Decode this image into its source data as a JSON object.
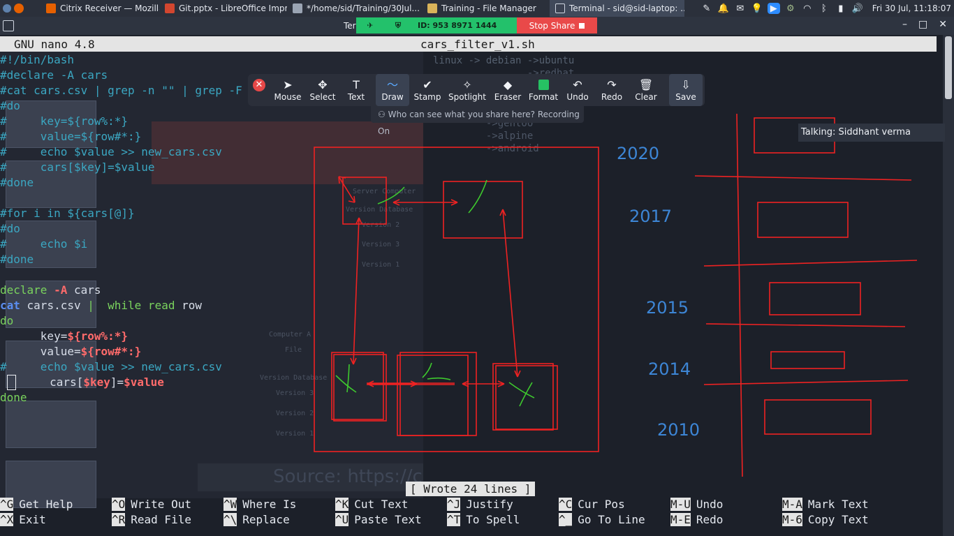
{
  "taskbar": {
    "tasks": [
      {
        "label": "Citrix Receiver — Mozilla F...",
        "icon": "firefox-icon"
      },
      {
        "label": "Git.pptx - LibreOffice Impr...",
        "icon": "impress-icon"
      },
      {
        "label": "*/home/sid/Training/30Jul...",
        "icon": "text-editor-icon"
      },
      {
        "label": "Training - File Manager",
        "icon": "folder-icon"
      },
      {
        "label": "Terminal - sid@sid-laptop: ...",
        "icon": "terminal-icon"
      }
    ],
    "clock": "Fri 30 Jul, 11:18:07"
  },
  "window": {
    "title_partial": "Ter",
    "share_id": "ID: 953 8971 1444",
    "stop_share": "Stop Share"
  },
  "nano": {
    "version": "GNU nano 4.8",
    "filename": "cars_filter_v1.sh",
    "status_message": "[ Wrote 24 lines ]",
    "lines": [
      [
        {
          "t": "#!/bin/bash",
          "c": "cmt"
        }
      ],
      [
        {
          "t": "#declare -A cars",
          "c": "cmt"
        }
      ],
      [
        {
          "t": "#cat cars.csv | grep -n \"\" | grep -F",
          "c": "cmt"
        }
      ],
      [
        {
          "t": "#do",
          "c": "cmt"
        }
      ],
      [
        {
          "t": "#     key=${row%:*}",
          "c": "cmt"
        }
      ],
      [
        {
          "t": "#     value=${row#*:}",
          "c": "cmt"
        }
      ],
      [
        {
          "t": "#     echo $value >> new_cars.csv",
          "c": "cmt"
        }
      ],
      [
        {
          "t": "#     cars[$key]=$value",
          "c": "cmt"
        }
      ],
      [
        {
          "t": "#done",
          "c": "cmt"
        }
      ],
      [
        {
          "t": "",
          "c": "def"
        }
      ],
      [
        {
          "t": "#for i in ${cars[@]}",
          "c": "cmt"
        }
      ],
      [
        {
          "t": "#do",
          "c": "cmt"
        }
      ],
      [
        {
          "t": "#     echo $i",
          "c": "cmt"
        }
      ],
      [
        {
          "t": "#done",
          "c": "cmt"
        }
      ],
      [
        {
          "t": "",
          "c": "def"
        }
      ],
      [
        {
          "t": "declare ",
          "c": "str"
        },
        {
          "t": "-A",
          "c": "var"
        },
        {
          "t": " cars",
          "c": "def"
        }
      ],
      [
        {
          "t": "cat",
          "c": "kw"
        },
        {
          "t": " cars.csv ",
          "c": "def"
        },
        {
          "t": "|  while read",
          "c": "str"
        },
        {
          "t": " row",
          "c": "def"
        }
      ],
      [
        {
          "t": "do",
          "c": "str"
        }
      ],
      [
        {
          "t": "      key=",
          "c": "def"
        },
        {
          "t": "${row%:*}",
          "c": "var"
        }
      ],
      [
        {
          "t": "      value=",
          "c": "def"
        },
        {
          "t": "${row#*:}",
          "c": "var"
        }
      ],
      [
        {
          "t": "#     echo $value >> new_cars.csv",
          "c": "cmt"
        }
      ],
      [
        {
          "t": "      cars[",
          "c": "def"
        },
        {
          "t": "$key",
          "c": "var"
        },
        {
          "t": "]=",
          "c": "def"
        },
        {
          "t": "$value",
          "c": "var"
        }
      ],
      [
        {
          "t": "done",
          "c": "str"
        }
      ]
    ],
    "shortcuts": [
      {
        "key": "^G",
        "label": "Get Help"
      },
      {
        "key": "^X",
        "label": "Exit"
      },
      {
        "key": "^O",
        "label": "Write Out"
      },
      {
        "key": "^R",
        "label": "Read File"
      },
      {
        "key": "^W",
        "label": "Where Is"
      },
      {
        "key": "^\\",
        "label": "Replace"
      },
      {
        "key": "^K",
        "label": "Cut Text"
      },
      {
        "key": "^U",
        "label": "Paste Text"
      },
      {
        "key": "^J",
        "label": "Justify"
      },
      {
        "key": "^T",
        "label": "To Spell"
      },
      {
        "key": "^C",
        "label": "Cur Pos"
      },
      {
        "key": "^_",
        "label": "Go To Line"
      },
      {
        "key": "M-U",
        "label": "Undo"
      },
      {
        "key": "M-E",
        "label": "Redo"
      },
      {
        "key": "M-A",
        "label": "Mark Text"
      },
      {
        "key": "M-6",
        "label": "Copy Text"
      }
    ]
  },
  "zoom_toolbar": {
    "tools": [
      {
        "label": "Mouse",
        "icon": "mouse-pointer-icon",
        "glyph": "➤"
      },
      {
        "label": "Select",
        "icon": "move-icon",
        "glyph": "✥"
      },
      {
        "label": "Text",
        "icon": "text-icon",
        "glyph": "T"
      },
      {
        "label": "Draw",
        "icon": "draw-icon",
        "glyph": "〜"
      },
      {
        "label": "Stamp",
        "icon": "stamp-icon",
        "glyph": "✔"
      },
      {
        "label": "Spotlight",
        "icon": "spotlight-icon",
        "glyph": "✧"
      },
      {
        "label": "Eraser",
        "icon": "eraser-icon",
        "glyph": "◆"
      },
      {
        "label": "Format",
        "icon": "format-color-icon",
        "glyph": ""
      },
      {
        "label": "Undo",
        "icon": "undo-icon",
        "glyph": "↶"
      },
      {
        "label": "Redo",
        "icon": "redo-icon",
        "glyph": "↷"
      },
      {
        "label": "Clear",
        "icon": "trash-icon",
        "glyph": "🗑"
      },
      {
        "label": "Save",
        "icon": "save-icon",
        "glyph": "⇩"
      }
    ],
    "selected": "Draw",
    "privacy_note": "Who can see what you share here? Recording On",
    "format_color": "#26c163"
  },
  "talking": "Talking: Siddhant verma",
  "annotation": {
    "stroke_color": "#ee2222",
    "mark_color": "#3ec92e",
    "years": [
      "2020",
      "2017",
      "2015",
      "2014",
      "2010"
    ]
  },
  "background_share": {
    "right_text": [
      "linux -> debian ->ubuntu",
      "                ->redhat"
    ],
    "right_text_lower": [
      "         ->gentoo",
      "         ->alpine",
      "         ->android"
    ],
    "source_text": "Source: https://c",
    "nodes": [
      "Server Computer",
      "Version Database",
      "Version 3",
      "Version 2",
      "Version 1",
      "Computer A",
      "File",
      "Version Database",
      "Version 3",
      "Version 2",
      "Version 1"
    ]
  }
}
